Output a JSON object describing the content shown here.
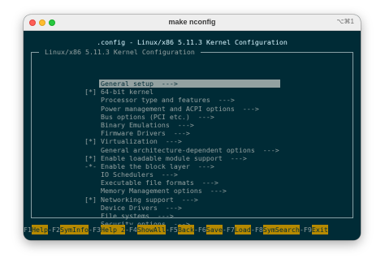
{
  "window": {
    "title": "make nconfig",
    "shortcut": "⌥⌘1"
  },
  "config_title": ".config - Linux/x86 5.11.3 Kernel Configuration",
  "frame_title": " Linux/x86 5.11.3 Kernel Configuration ",
  "menu": [
    {
      "prefix": "",
      "label": "General setup  --->",
      "selected": true
    },
    {
      "prefix": "[*]",
      "label": "64-bit kernel"
    },
    {
      "prefix": "",
      "label": "Processor type and features  --->"
    },
    {
      "prefix": "",
      "label": "Power management and ACPI options  --->"
    },
    {
      "prefix": "",
      "label": "Bus options (PCI etc.)  --->"
    },
    {
      "prefix": "",
      "label": "Binary Emulations  --->"
    },
    {
      "prefix": "",
      "label": "Firmware Drivers  --->"
    },
    {
      "prefix": "[*]",
      "label": "Virtualization  --->"
    },
    {
      "prefix": "",
      "label": "General architecture-dependent options  --->"
    },
    {
      "prefix": "[*]",
      "label": "Enable loadable module support  --->"
    },
    {
      "prefix": "-*-",
      "label": "Enable the block layer  --->"
    },
    {
      "prefix": "",
      "label": "IO Schedulers  --->"
    },
    {
      "prefix": "",
      "label": "Executable file formats  --->"
    },
    {
      "prefix": "",
      "label": "Memory Management options  --->"
    },
    {
      "prefix": "[*]",
      "label": "Networking support  --->"
    },
    {
      "prefix": "",
      "label": "Device Drivers  --->"
    },
    {
      "prefix": "",
      "label": "File systems  --->"
    },
    {
      "prefix": "",
      "label": "Security options  --->"
    }
  ],
  "function_keys": [
    {
      "key": "F1",
      "label": "Help"
    },
    {
      "key": "-F2",
      "label": "SymInfo"
    },
    {
      "key": "-F3",
      "label": "Help 2"
    },
    {
      "key": "-F4",
      "label": "ShowAll"
    },
    {
      "key": "-F5",
      "label": "Back"
    },
    {
      "key": "-F6",
      "label": "Save"
    },
    {
      "key": "-F7",
      "label": "Load"
    },
    {
      "key": "-F8",
      "label": "SymSearch"
    },
    {
      "key": "-F9",
      "label": "Exit"
    }
  ],
  "colors": {
    "terminal_bg": "#002b36",
    "text": "#93a1a1",
    "title_text": "#d7f5ff",
    "fkey_label_bg": "#b58900"
  }
}
